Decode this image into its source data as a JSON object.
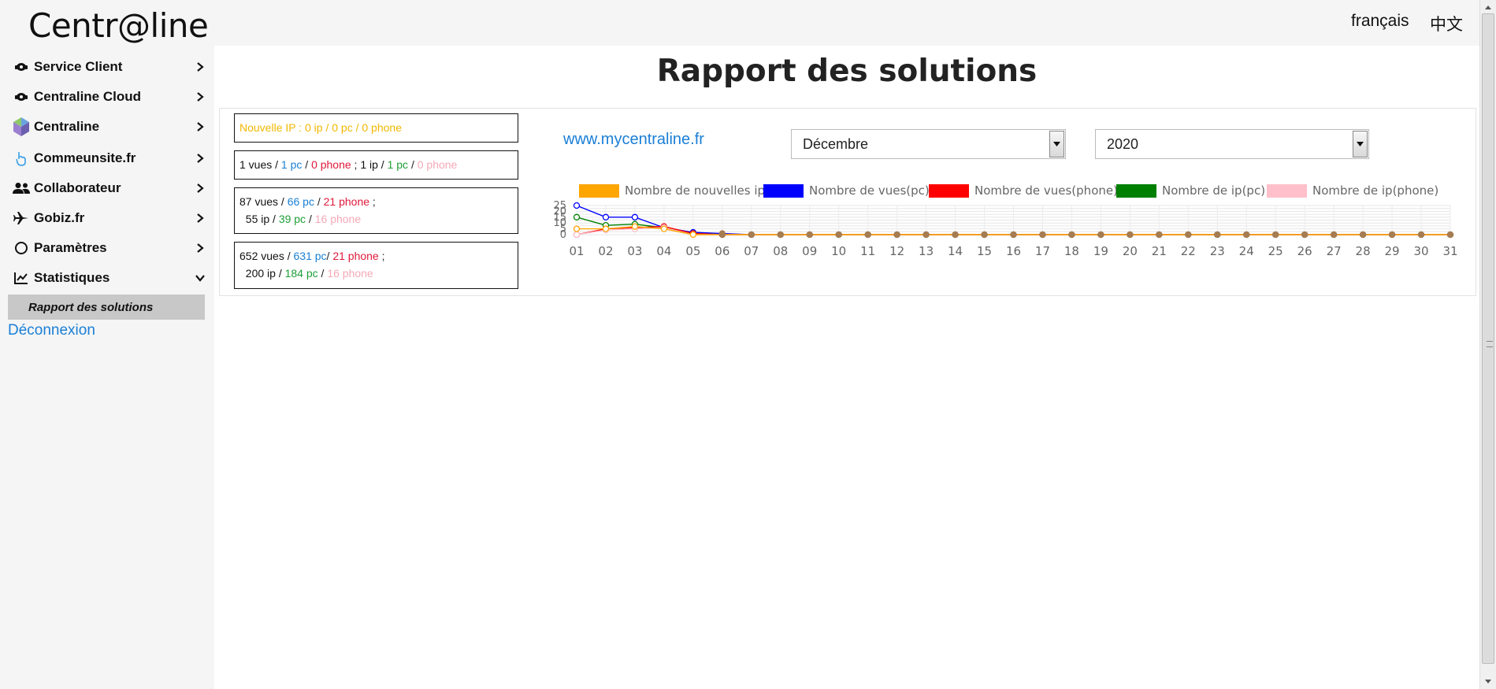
{
  "app": {
    "logo": "Centr@line",
    "languages": [
      "français",
      "中文"
    ]
  },
  "sidebar": {
    "items": [
      {
        "label": "Service Client",
        "icon": "support-icon"
      },
      {
        "label": "Centraline Cloud",
        "icon": "cloud-icon"
      },
      {
        "label": "Centraline",
        "icon": "centraline-logo-icon"
      },
      {
        "label": "Commeunsite.fr",
        "icon": "hand-icon"
      },
      {
        "label": "Collaborateur",
        "icon": "users-icon"
      },
      {
        "label": "Gobiz.fr",
        "icon": "plane-icon"
      },
      {
        "label": "Paramètres",
        "icon": "circle-icon"
      },
      {
        "label": "Statistiques",
        "icon": "chart-line-icon"
      }
    ],
    "active_sub_item": "Rapport des solutions",
    "logout": "Déconnexion"
  },
  "main": {
    "title": "Rapport des solutions",
    "stats": {
      "box1": {
        "text": "Nouvelle IP : 0 ip / 0 pc / 0 phone"
      },
      "box2": {
        "vues": "1 vues /",
        "pc": "1 pc",
        "phone": "0 phone",
        "ip": "1 ip /",
        "ip_pc": "1 pc",
        "ip_phone": "0 phone"
      },
      "box3": {
        "vues": "87 vues /",
        "pc": "66 pc",
        "phone": "21 phone",
        "ip": "55 ip /",
        "ip_pc": "39 pc",
        "ip_phone": "16 phone"
      },
      "box4": {
        "vues": "652 vues /",
        "pc": "631 pc",
        "phone": "21 phone",
        "ip": "200 ip /",
        "ip_pc": "184 pc",
        "ip_phone": "16 phone"
      }
    },
    "site_link": "www.mycentraline.fr",
    "month_select": {
      "value": "Décembre"
    },
    "year_select": {
      "value": "2020"
    }
  },
  "chart_data": {
    "type": "line",
    "categories": [
      "01",
      "02",
      "03",
      "04",
      "05",
      "06",
      "07",
      "08",
      "09",
      "10",
      "11",
      "12",
      "13",
      "14",
      "15",
      "16",
      "17",
      "18",
      "19",
      "20",
      "21",
      "22",
      "23",
      "24",
      "25",
      "26",
      "27",
      "28",
      "29",
      "30",
      "31"
    ],
    "yticks": [
      "25",
      "20",
      "15",
      "10",
      "5",
      "0"
    ],
    "ylim": [
      0,
      25
    ],
    "series": [
      {
        "name": "Nombre de nouvelles ip",
        "color": "#ffa500",
        "values": [
          5,
          5,
          7,
          5,
          0,
          0,
          0,
          0,
          0,
          0,
          0,
          0,
          0,
          0,
          0,
          0,
          0,
          0,
          0,
          0,
          0,
          0,
          0,
          0,
          0,
          0,
          0,
          0,
          0,
          0,
          0
        ]
      },
      {
        "name": "Nombre de vues(pc)",
        "color": "#0000ff",
        "values": [
          25,
          15,
          15,
          6,
          2,
          1,
          0,
          0,
          0,
          0,
          0,
          0,
          0,
          0,
          0,
          0,
          0,
          0,
          0,
          0,
          0,
          0,
          0,
          0,
          0,
          0,
          0,
          0,
          0,
          0,
          0
        ]
      },
      {
        "name": "Nombre de vues(phone)",
        "color": "#ff0000",
        "values": [
          0,
          5,
          6,
          7,
          1,
          0,
          0,
          0,
          0,
          0,
          0,
          0,
          0,
          0,
          0,
          0,
          0,
          0,
          0,
          0,
          0,
          0,
          0,
          0,
          0,
          0,
          0,
          0,
          0,
          0,
          0
        ]
      },
      {
        "name": "Nombre de ip(pc)",
        "color": "#008000",
        "values": [
          15,
          8,
          9,
          6,
          1,
          0,
          0,
          0,
          0,
          0,
          0,
          0,
          0,
          0,
          0,
          0,
          0,
          0,
          0,
          0,
          0,
          0,
          0,
          0,
          0,
          0,
          0,
          0,
          0,
          0,
          0
        ]
      },
      {
        "name": "Nombre de ip(phone)",
        "color": "#ffc0cb",
        "values": [
          0,
          4,
          5,
          6,
          0,
          0,
          0,
          0,
          0,
          0,
          0,
          0,
          0,
          0,
          0,
          0,
          0,
          0,
          0,
          0,
          0,
          0,
          0,
          0,
          0,
          0,
          0,
          0,
          0,
          0,
          0
        ]
      }
    ],
    "grid": true,
    "legend_position": "top"
  }
}
